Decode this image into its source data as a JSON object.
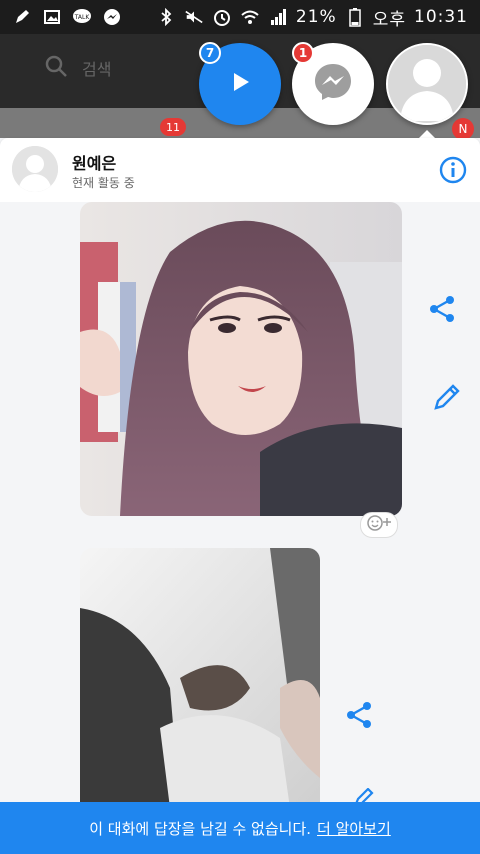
{
  "status_bar": {
    "battery": "21%",
    "ampm": "오후",
    "time": "10:31",
    "left_icons": [
      "pen-icon",
      "image-icon",
      "talk-icon",
      "messenger-icon"
    ],
    "right_icons": [
      "bluetooth-icon",
      "mute-icon",
      "alarm-icon",
      "wifi-icon",
      "signal-icon",
      "battery-icon"
    ]
  },
  "background_app": {
    "search_placeholder": "검색",
    "badge_count": "11",
    "badge_letter": "N"
  },
  "chat_heads": {
    "video_count": "7",
    "messenger_count": "1"
  },
  "conversation": {
    "contact_name": "원예은",
    "contact_status": "현재 활동 중"
  },
  "footer": {
    "message": "이 대화에 답장을 남길 수 없습니다.",
    "link": "더 알아보기"
  },
  "colors": {
    "accent": "#1f86ef",
    "badge": "#e53935",
    "status_bar": "#1c1c1c"
  }
}
